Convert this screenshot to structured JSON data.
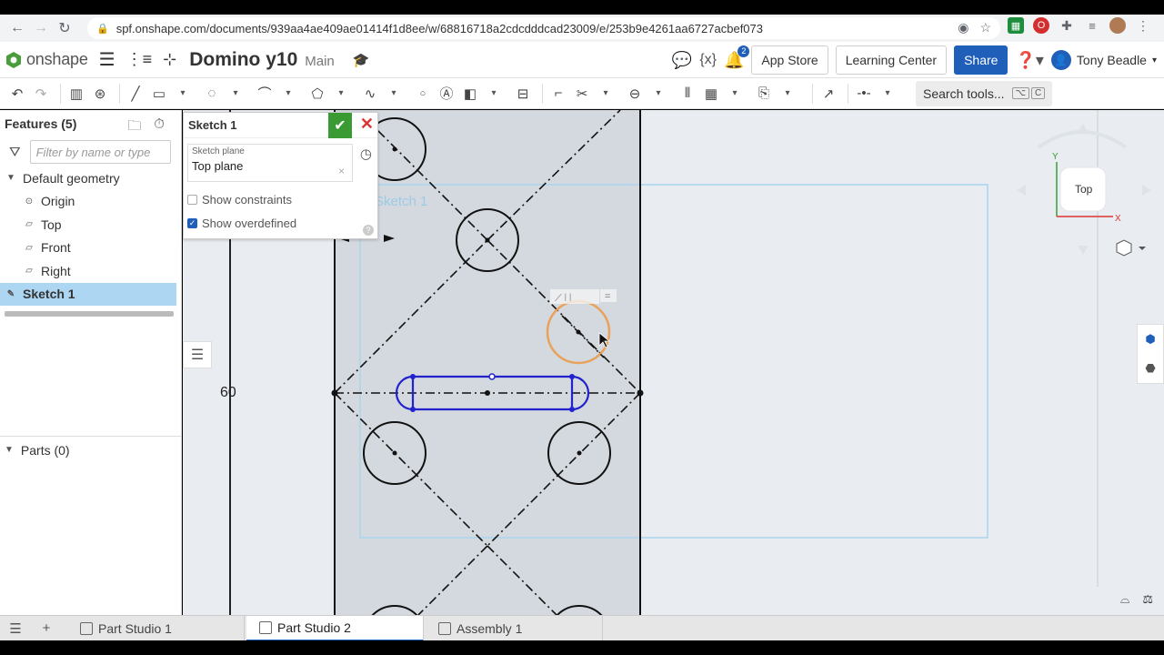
{
  "browser": {
    "url": "spf.onshape.com/documents/939aa4ae409ae01414f1d8ee/w/68816718a2cdcdddcad23009/e/253b9e4261aa6727acbef073"
  },
  "header": {
    "logo_text": "onshape",
    "doc_title": "Domino y10",
    "branch": "Main",
    "notification_count": "2",
    "app_store": "App Store",
    "learning_center": "Learning Center",
    "share": "Share",
    "user_name": "Tony Beadle"
  },
  "toolbar": {
    "search_tools": "Search tools...",
    "shortcut_key1": "⌥",
    "shortcut_key2": "C"
  },
  "feature_panel": {
    "title": "Features (5)",
    "filter_placeholder": "Filter by name or type",
    "tree": [
      {
        "label": "Default geometry"
      },
      {
        "label": "Origin"
      },
      {
        "label": "Top"
      },
      {
        "label": "Front"
      },
      {
        "label": "Right"
      },
      {
        "label": "Sketch 1"
      }
    ],
    "parts_label": "Parts (0)"
  },
  "sketch_dialog": {
    "title": "Sketch 1",
    "plane_label": "Sketch plane",
    "plane_value": "Top plane",
    "show_constraints": "Show constraints",
    "show_overdefined": "Show overdefined",
    "show_constraints_checked": false,
    "show_overdefined_checked": true
  },
  "canvas": {
    "dimension_value": "60",
    "plane_label": "Sketch 1",
    "view_cube_label": "Top",
    "axis_y": "Y",
    "axis_x": "X"
  },
  "tabs": [
    {
      "label": "Part Studio 1"
    },
    {
      "label": "Part Studio 2"
    },
    {
      "label": "Assembly 1"
    }
  ],
  "colors": {
    "accent": "#1f5fb9",
    "sketch_selected": "#2222cc",
    "preselect": "#e8a25a",
    "plane": "#a9d4ee",
    "ok_green": "#3a9b35"
  }
}
